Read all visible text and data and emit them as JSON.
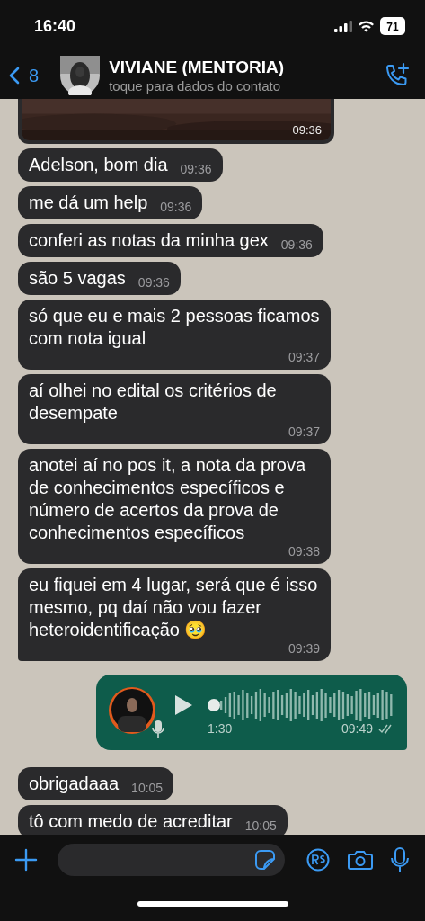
{
  "status_bar": {
    "time": "16:40",
    "battery": "71"
  },
  "header": {
    "back_count": "8",
    "name": "VIVIANE (MENTORIA)",
    "subtitle": "toque para dados do contato"
  },
  "messages": [
    {
      "time": "09:36"
    },
    {
      "kind": "text",
      "text": "Adelson, bom dia",
      "time": "09:36"
    },
    {
      "kind": "text",
      "text": "me dá um help",
      "time": "09:36"
    },
    {
      "kind": "text",
      "text": "conferi as notas da minha gex",
      "time": "09:36"
    },
    {
      "kind": "text",
      "text": "são 5 vagas",
      "time": "09:36"
    },
    {
      "kind": "text",
      "text": "só que eu e mais 2 pessoas ficamos com nota igual",
      "time": "09:37"
    },
    {
      "kind": "text",
      "text": "aí olhei no edital os critérios de desempate",
      "time": "09:37"
    },
    {
      "kind": "text",
      "text": "anotei aí no pos it, a nota da prova de conhecimentos específicos e número de acertos da prova de conhecimentos específicos",
      "time": "09:38"
    },
    {
      "kind": "text",
      "text": "eu fiquei em 4 lugar, será que é isso mesmo, pq daí não vou fazer heteroidentificação 🥹",
      "time": "09:39",
      "tail": true
    },
    {
      "kind": "voice",
      "outgoing": true,
      "duration": "1:30",
      "time": "09:49",
      "level": 0,
      "read": false
    },
    {
      "kind": "text",
      "text": "obrigadaaa",
      "time": "10:05"
    },
    {
      "kind": "text",
      "text": "tô com medo de acreditar",
      "time": "10:05"
    }
  ]
}
